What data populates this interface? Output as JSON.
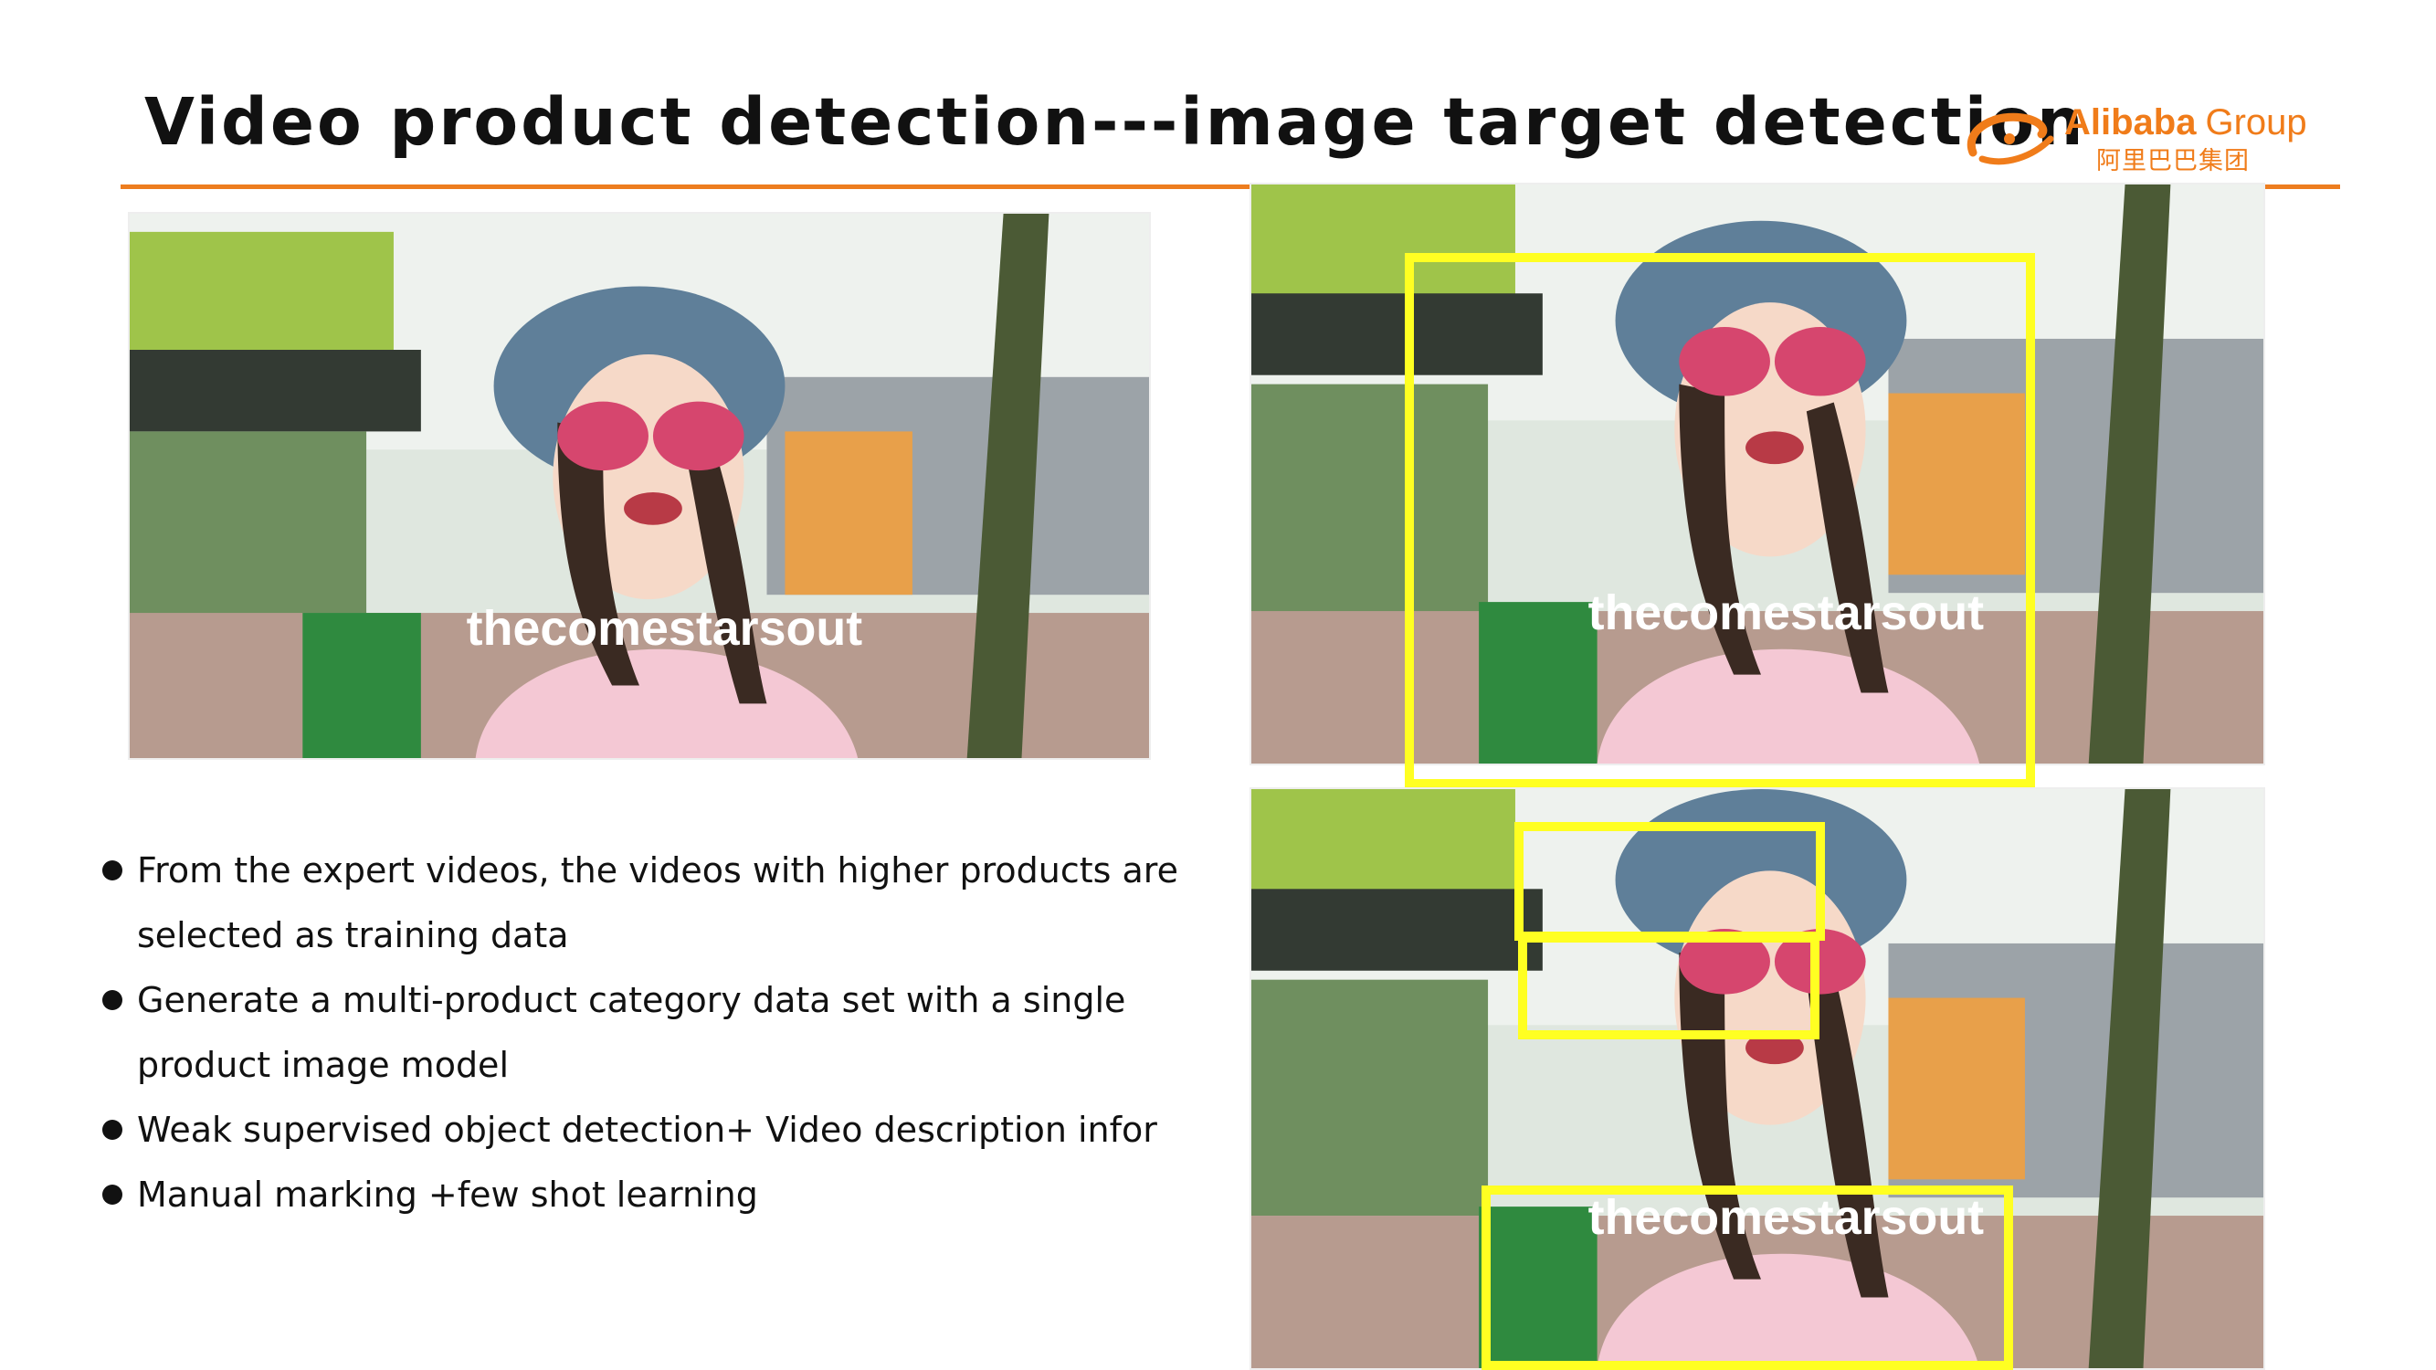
{
  "slide": {
    "title": "Video product detection---image target detection",
    "accent_color": "#ed7d1f",
    "box_color": "#ffff22"
  },
  "logo": {
    "brand": "Alibaba",
    "group": "Group",
    "chinese": "阿里巴巴集团"
  },
  "images": [
    {
      "label": "video frame original",
      "overlay_text": "thecomestarsout"
    },
    {
      "label": "video frame with full-body detection box",
      "overlay_text": "thecomestarsout"
    },
    {
      "label": "video frame with hat, sunglasses and top detection boxes",
      "overlay_text": "thecomestarsout"
    }
  ],
  "bullets": [
    "From the expert videos, the videos with higher products are selected as training data",
    "Generate a multi-product category data set with a single product image model",
    "Weak supervised object detection+ Video description infor",
    "Manual marking +few shot learning"
  ]
}
